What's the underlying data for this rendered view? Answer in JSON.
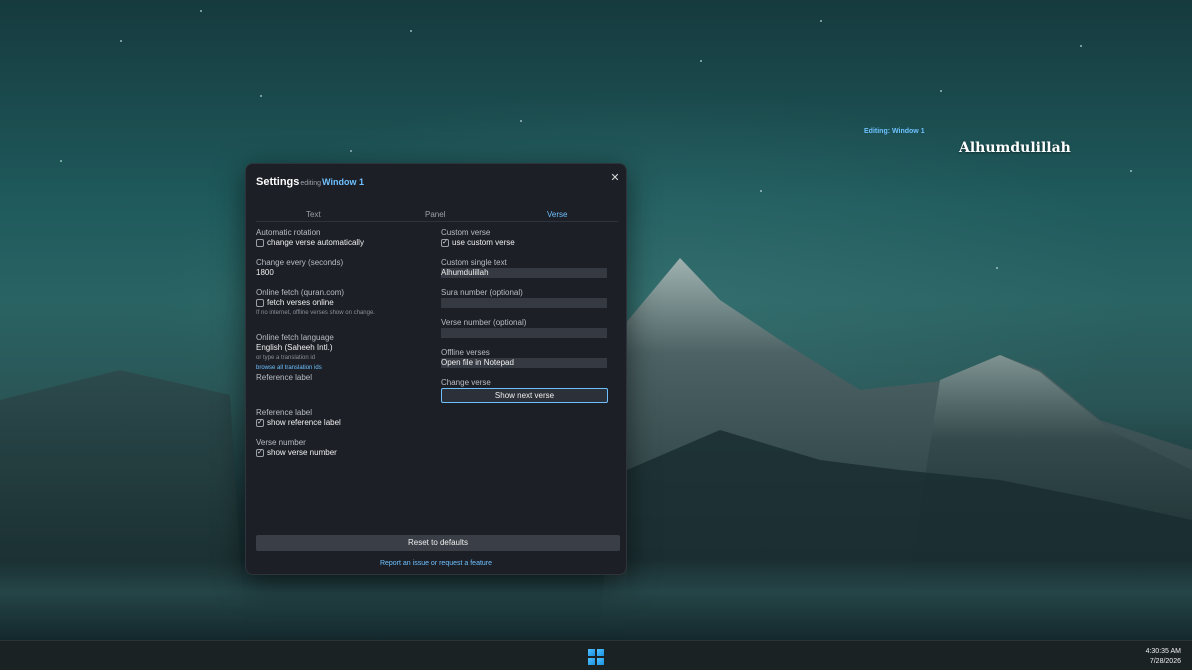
{
  "overlay": {
    "editing_label": "Editing: Window 1",
    "verse_text": "Alhumdulillah"
  },
  "settings": {
    "title": "Settings",
    "editing": "editing",
    "window_name": "Window 1",
    "close_glyph": "✕",
    "tabs": [
      {
        "label": "Text",
        "active": false
      },
      {
        "label": "Panel",
        "active": false
      },
      {
        "label": "Verse",
        "active": true
      }
    ],
    "left": {
      "automatic_rotation": {
        "label": "Automatic rotation",
        "checkbox_label": "change verse automatically",
        "checked": false
      },
      "change_every": {
        "label": "Change every (seconds)",
        "value": "1800"
      },
      "online_fetch": {
        "label": "Online fetch (quran.com)",
        "checkbox_label": "fetch verses online",
        "checked": false,
        "hint": "If no internet, offline verses show on change."
      },
      "fetch_language": {
        "label": "Online fetch language",
        "value": "English (Saheeh Intl.)",
        "hint": "or type a translation id",
        "link": "browse all translation ids",
        "extra": "Reference label"
      },
      "reference_label": {
        "label": "Reference label",
        "checkbox_label": "show reference label",
        "checked": true
      },
      "verse_number": {
        "label": "Verse number",
        "checkbox_label": "show verse number",
        "checked": true
      }
    },
    "right": {
      "custom_verse": {
        "label": "Custom verse",
        "checkbox_label": "use custom verse",
        "checked": true
      },
      "custom_single_text": {
        "label": "Custom single text",
        "value": "Alhumdulillah"
      },
      "sura_number": {
        "label": "Sura number (optional)",
        "value": ""
      },
      "verse_number_opt": {
        "label": "Verse number (optional)",
        "value": ""
      },
      "offline_verses": {
        "label": "Offline verses",
        "button_label": "Open file in Notepad"
      },
      "change_verse": {
        "label": "Change verse",
        "button_label": "Show next verse"
      }
    },
    "reset_label": "Reset to defaults",
    "report_link": "Report an issue or request a feature"
  },
  "taskbar": {
    "start_icon": "windows-logo-icon",
    "time": "4:30:35 AM",
    "date": "7/28/2026"
  },
  "colors": {
    "accent": "#6ec1ff",
    "panel_bg": "#1c1f26"
  }
}
